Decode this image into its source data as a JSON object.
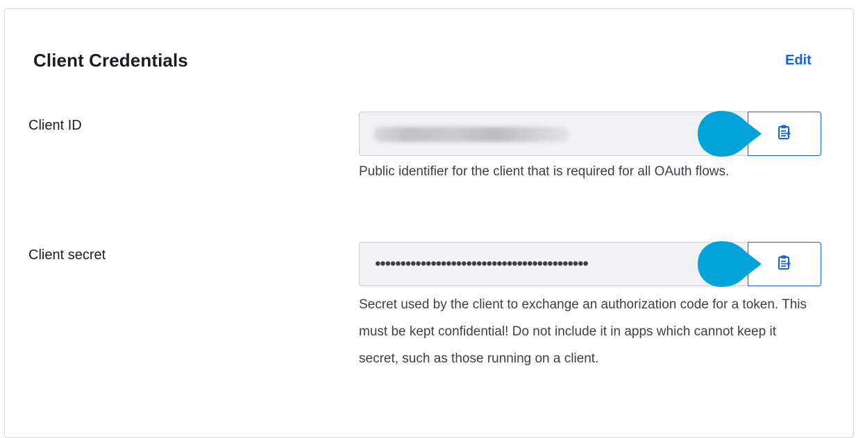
{
  "section": {
    "title": "Client Credentials",
    "edit_label": "Edit"
  },
  "client_id": {
    "label": "Client ID",
    "description": "Public identifier for the client that is required for all OAuth flows.",
    "copy_icon": "clipboard-copy-icon"
  },
  "client_secret": {
    "label": "Client secret",
    "masked_value": "••••••••••••••••••••••••••••••••••••••••••",
    "description": "Secret used by the client to exchange an authorization code for a token. This must be kept confidential! Do not include it in apps which cannot keep it secret, such as those running on a client.",
    "copy_icon": "clipboard-copy-icon"
  },
  "colors": {
    "accent": "#1662dd",
    "pointer": "#00a3d9",
    "input_background": "#f2f2f4"
  }
}
